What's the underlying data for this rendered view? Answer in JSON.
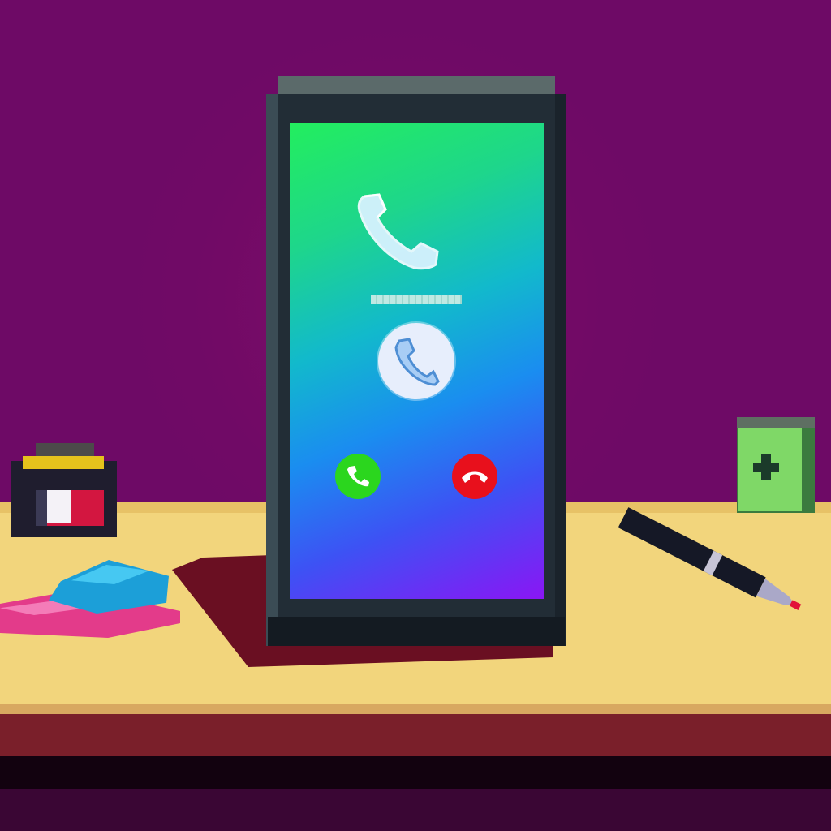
{
  "scene": {
    "description_label": "",
    "colors": {
      "wall": "#6e0a66",
      "desk_top": "#f2d57c",
      "desk_front": "#7a1f2a",
      "screen_gradient_start": "#23ee5e",
      "screen_gradient_end": "#8a16f4",
      "answer_button": "#2bd61e",
      "decline_button": "#e8101c"
    }
  },
  "phone": {
    "call_screen": {
      "caller_name": "",
      "call_icon": "phone-handset-icon",
      "avatar_icon": "phone-icon",
      "answer": {
        "icon": "phone-answer-icon",
        "color": "#2bd61e"
      },
      "decline": {
        "icon": "phone-hangup-icon",
        "color": "#e8101c"
      }
    }
  },
  "props": {
    "left": [
      "camera-icon",
      "eraser-icon"
    ],
    "right": [
      "first-aid-box-icon",
      "pen-icon"
    ]
  }
}
